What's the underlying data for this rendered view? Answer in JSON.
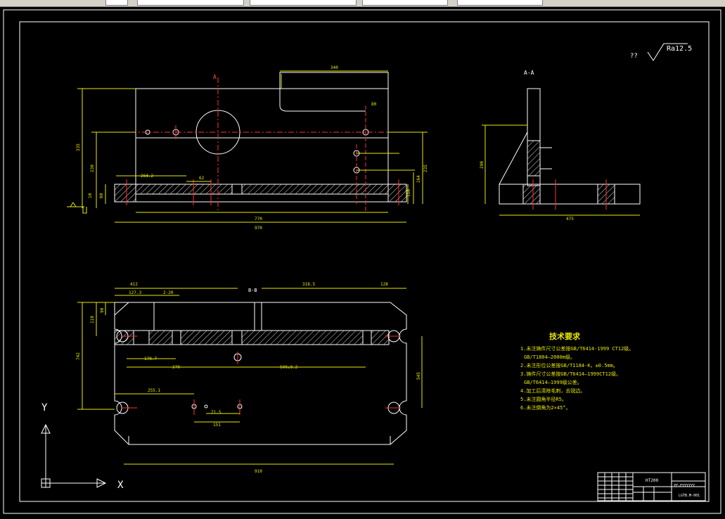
{
  "drawing": {
    "section_label_a": "A",
    "section_view_label": "A-A",
    "section_label_b": "B-B",
    "roughness_prefix": "??",
    "roughness_value": "Ra12.5",
    "dims_front": {
      "d340": "340",
      "d970": "970",
      "d770": "770",
      "d335": "335",
      "d230": "230",
      "d60": "60",
      "d10": "10",
      "d110": "110",
      "d164": "164",
      "d235": "235",
      "d264": "264.2",
      "d62": "62",
      "d80": "80"
    },
    "dims_side": {
      "d290": "290",
      "d475": "475"
    },
    "dims_top": {
      "d412": "412",
      "d318": "318.5",
      "d128": "128",
      "d127": "127.3",
      "d2x20": "2-20",
      "d178": "178.7",
      "d270": "270",
      "d500": "500±0.2",
      "d255": "255.1",
      "d910": "910",
      "d742": "742",
      "d545": "545",
      "d151": "151",
      "d71": "71.5",
      "d110": "110",
      "d90": "90"
    },
    "axes": {
      "y": "Y",
      "x": "X"
    }
  },
  "notes": {
    "title": "技术要求",
    "items": [
      "1.未注铸件尺寸公差按GB/T6414-1999 CT12级。",
      "GB/T1804—2000m级。",
      "2.未注形位公差按GB/T1184-K，±0.5mm。",
      "3.铸件尺寸公差按GB/T6414—1999CT12级。",
      "GB/T6414—1999级公差。",
      "4.加工后清除毛刺，去锐边。",
      "5.未注圆角半径R5。",
      "6.未注倒角为2×45°。"
    ]
  },
  "title_block": {
    "material": "HT200",
    "drawing_no": "YF-FYYYYYY",
    "part_code": "LGTB.M-001"
  }
}
